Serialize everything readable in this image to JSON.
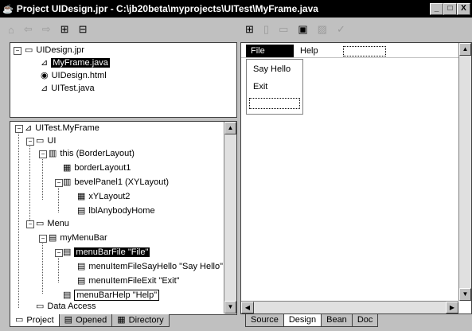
{
  "window": {
    "title": "Project UIDesign.jpr - C:\\jb20beta\\myprojects\\UITest\\MyFrame.java",
    "min": "_",
    "max": "□",
    "close": "X"
  },
  "project_tree": {
    "root": "UIDesign.jpr",
    "items": [
      "MyFrame.java",
      "UIDesign.html",
      "UITest.java"
    ]
  },
  "structure_tree": {
    "root": "UITest.MyFrame",
    "ui": "UI",
    "this": "this (BorderLayout)",
    "borderLayout": "borderLayout1",
    "bevelPanel": "bevelPanel1 (XYLayout)",
    "xyLayout": "xYLayout2",
    "lbl": "lblAnybodyHome",
    "menu": "Menu",
    "menuBar": "myMenuBar",
    "menuBarFile": "menuBarFile \"File\"",
    "sayHello": "menuItemFileSayHello \"Say Hello\"",
    "exit": "menuItemFileExit \"Exit\"",
    "help": "menuBarHelp \"Help\"",
    "dataAccess": "Data Access"
  },
  "left_tabs": [
    "Project",
    "Opened",
    "Directory"
  ],
  "right_tabs": [
    "Source",
    "Design",
    "Bean",
    "Doc"
  ],
  "designer": {
    "menubar": [
      "File",
      "Help"
    ],
    "file_menu": [
      "Say Hello",
      "Exit"
    ]
  }
}
